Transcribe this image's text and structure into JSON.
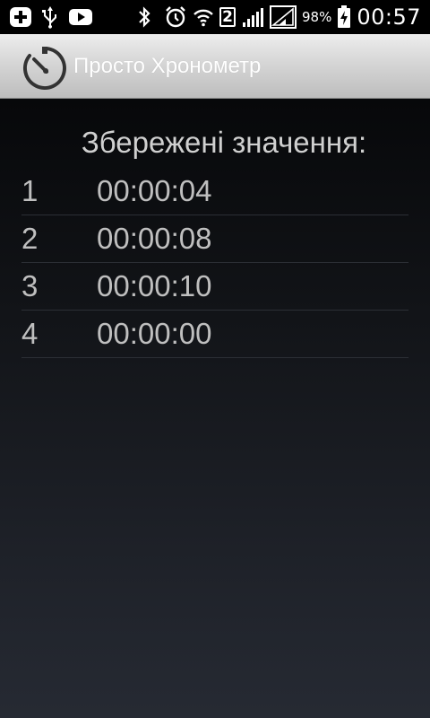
{
  "status_bar": {
    "icons_left": [
      "plus-box-icon",
      "usb-icon",
      "youtube-icon"
    ],
    "icons_right": [
      "bluetooth-icon",
      "alarm-icon",
      "wifi-icon",
      "sim-2-icon",
      "signal-icon",
      "signal-icon-2",
      "battery-charging-icon"
    ],
    "sim_label": "2",
    "battery_percent": "98%",
    "time": "00:57"
  },
  "action_bar": {
    "title": "Просто Хронометр",
    "background": "#d6d6d6"
  },
  "content": {
    "heading": "Збережені значення:",
    "rows": [
      {
        "index": "1",
        "time": "00:00:04"
      },
      {
        "index": "2",
        "time": "00:00:08"
      },
      {
        "index": "3",
        "time": "00:00:10"
      },
      {
        "index": "4",
        "time": "00:00:00"
      }
    ],
    "text_color": "#bfbfbf"
  }
}
